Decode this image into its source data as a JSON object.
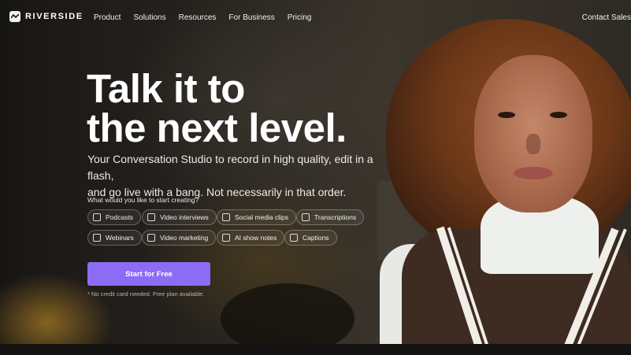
{
  "nav": {
    "logo_text": "RIVERSIDE",
    "links": [
      "Product",
      "Solutions",
      "Resources",
      "For Business",
      "Pricing"
    ],
    "contact": "Contact Sales"
  },
  "hero": {
    "title_line1": "Talk it to",
    "title_line2": "the next level.",
    "subtitle_line1": "Your Conversation Studio to record in high quality, edit in a flash,",
    "subtitle_line2": "and go live with a bang. Not necessarily in that order.",
    "question": "What would you like to start creating?",
    "options": [
      "Podcasts",
      "Video interviews",
      "Social media clips",
      "Transcriptions",
      "Webinars",
      "Video marketing",
      "AI show notes",
      "Captions"
    ],
    "cta": "Start for Free",
    "note": "* No credit card needed. Free plan available."
  },
  "colors": {
    "accent": "#8c6cf5",
    "background": "#1a1816"
  }
}
